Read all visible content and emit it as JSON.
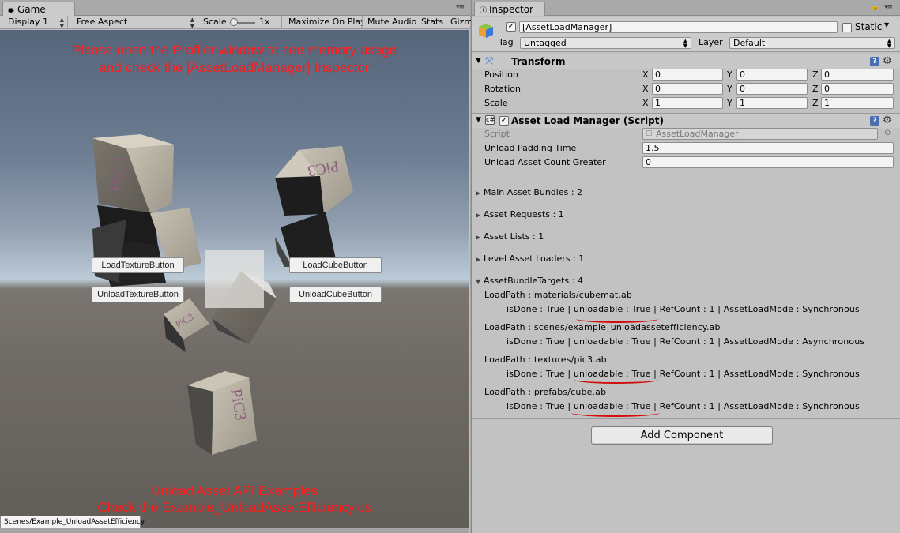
{
  "game": {
    "tab_label": "Game",
    "display": "Display 1",
    "aspect": "Free Aspect",
    "scale_label": "Scale",
    "scale_value": "1x",
    "maximize_on_play": "Maximize On Play",
    "mute_audio": "Mute Audio",
    "stats": "Stats",
    "gizmos": "Gizm",
    "overlay_top_line1": "Please open the Profiler window to see memory usage",
    "overlay_top_line2": "and check the [AssetLoadManager] Inspector",
    "overlay_bottom_line1": "Unload Asset API Examples",
    "overlay_bottom_line2": "Check the Example_UnloadAssetEfficiency.cs",
    "buttons": {
      "load_texture": "LoadTextureButton",
      "unload_texture": "UnloadTextureButton",
      "load_cube": "LoadCubeButton",
      "unload_cube": "UnloadCubeButton"
    },
    "cube_label": "PiC3",
    "scene_dropdown": "Scenes/Example_UnloadAssetEfficiency"
  },
  "inspector": {
    "tab_label": "Inspector",
    "object_name": "[AssetLoadManager]",
    "static_label": "Static",
    "tag_label": "Tag",
    "tag_value": "Untagged",
    "layer_label": "Layer",
    "layer_value": "Default",
    "transform": {
      "title": "Transform",
      "rows": [
        {
          "label": "Position",
          "x": "0",
          "y": "0",
          "z": "0"
        },
        {
          "label": "Rotation",
          "x": "0",
          "y": "0",
          "z": "0"
        },
        {
          "label": "Scale",
          "x": "1",
          "y": "1",
          "z": "1"
        }
      ]
    },
    "script_component": {
      "title": "Asset Load Manager (Script)",
      "script_label": "Script",
      "script_value": "AssetLoadManager",
      "unload_padding_label": "Unload Padding Time",
      "unload_padding_value": "1.5",
      "unload_count_label": "Unload Asset Count Greater",
      "unload_count_value": "0"
    },
    "foldouts": [
      "Main Asset Bundles : 2",
      "Asset Requests : 1",
      "Asset Lists : 1",
      "Level Asset Loaders : 1",
      "AssetBundleTargets : 4"
    ],
    "targets": [
      {
        "path": "LoadPath : materials/cubemat.ab",
        "status": "isDone : True | unloadable : True | RefCount : 1 | AssetLoadMode : Synchronous"
      },
      {
        "path": "LoadPath : scenes/example_unloadassetefficiency.ab",
        "status": "isDone : True | unloadable : True | RefCount : 1 | AssetLoadMode : Asynchronous"
      },
      {
        "path": "LoadPath : textures/pic3.ab",
        "status": "isDone : True | unloadable : True | RefCount : 1 | AssetLoadMode : Synchronous"
      },
      {
        "path": "LoadPath : prefabs/cube.ab",
        "status": "isDone : True | unloadable : True | RefCount : 1 | AssetLoadMode : Synchronous"
      }
    ],
    "add_component": "Add Component"
  }
}
